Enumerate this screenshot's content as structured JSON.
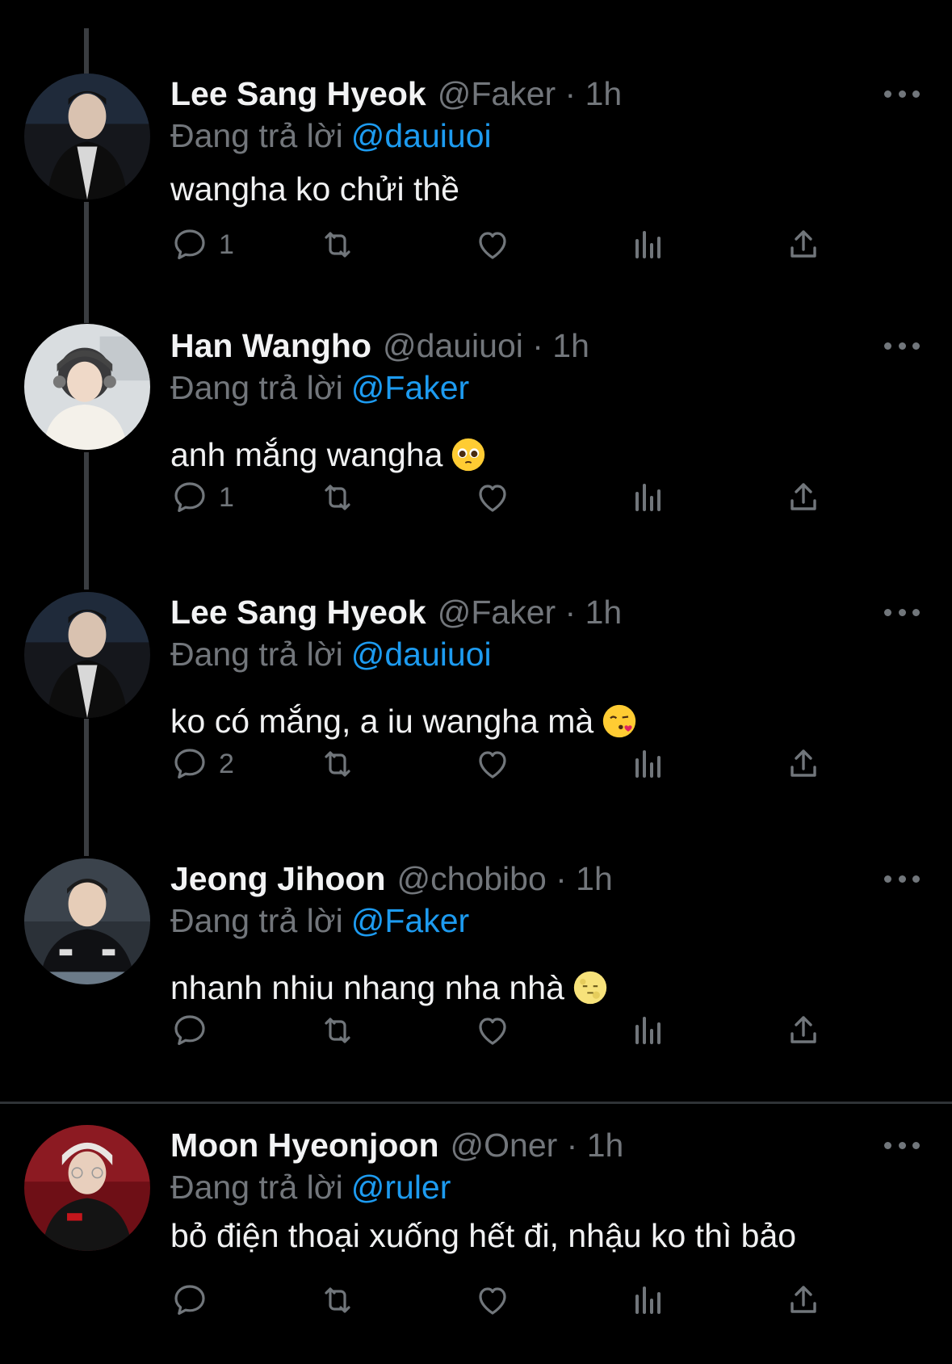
{
  "tweets": [
    {
      "name": "Lee Sang Hyeok",
      "handle": "@Faker · 1h",
      "replying_label": "Đang trả lời",
      "replying_to": "@dauiuoi",
      "text": "wangha ko chửi thề",
      "reply_count": "1"
    },
    {
      "name": "Han Wangho",
      "handle": "@dauiuoi · 1h",
      "replying_label": "Đang trả lời",
      "replying_to": "@Faker",
      "text": " anh mắng wangha",
      "reply_count": "1"
    },
    {
      "name": "Lee Sang Hyeok",
      "handle": "@Faker · 1h",
      "replying_label": "Đang trả lời",
      "replying_to": "@dauiuoi",
      "text": "ko có mắng, a iu wangha mà",
      "reply_count": "2"
    },
    {
      "name": "Jeong Jihoon",
      "handle": "@chobibo · 1h",
      "replying_label": "Đang trả lời",
      "replying_to": "@Faker",
      "text": "nhanh nhiu nhang nha nhà",
      "reply_count": ""
    },
    {
      "name": "Moon Hyeonjoon",
      "handle": "@Oner · 1h",
      "replying_label": "Đang trả lời",
      "replying_to": "@ruler",
      "text": "bỏ điện thoại xuống hết đi, nhậu ko thì bảo",
      "reply_count": ""
    }
  ],
  "colors": {
    "background": "#000000",
    "mention": "#1d9bf0",
    "muted": "#71767b",
    "thread_line": "#3a3d41"
  },
  "icons": [
    "reply-icon",
    "retweet-icon",
    "like-icon",
    "views-icon",
    "share-icon",
    "more-icon"
  ]
}
